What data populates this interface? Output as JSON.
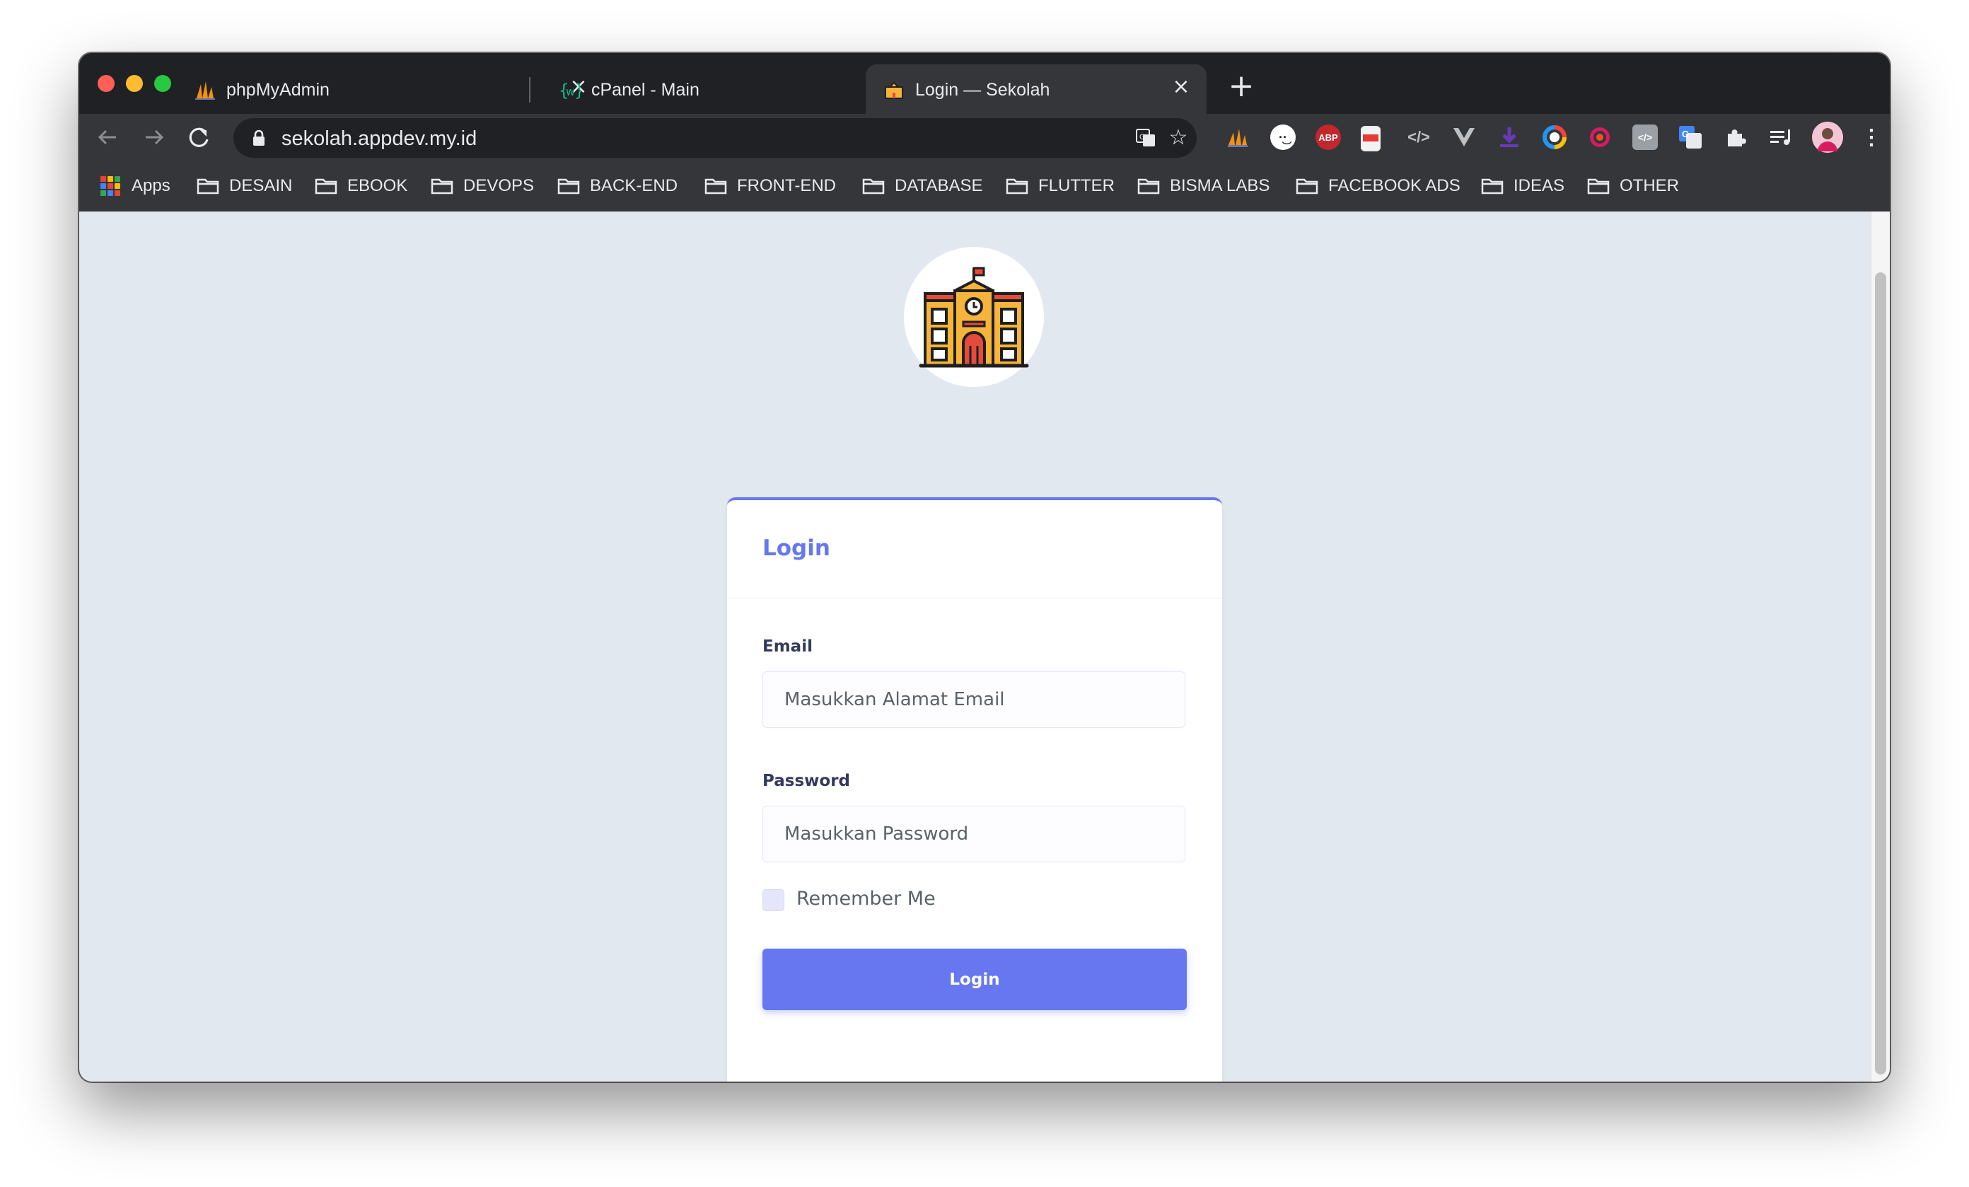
{
  "browser": {
    "tabs": [
      {
        "title": "phpMyAdmin",
        "icon": "phpmyadmin-sails-icon",
        "active": false
      },
      {
        "title": "cPanel - Main",
        "icon": "cpanel-braces-icon",
        "active": false
      },
      {
        "title": "Login — Sekolah",
        "icon": "school-building-icon",
        "active": true
      }
    ],
    "new_tab_icon": "plus-icon",
    "url": "sekolah.appdev.my.id",
    "extensions": [
      "sails-icon",
      "emoji-icon",
      "ABP",
      "pdf-icon",
      "code-icon",
      "vue-icon",
      "download-icon",
      "chromatic-icon",
      "target-icon",
      "code-box-icon",
      "translate-icon",
      "puzzle-icon",
      "media-icon",
      "avatar"
    ],
    "extension_labels": {
      "abp": "ABP"
    },
    "bookmarks": [
      {
        "label": "Apps",
        "type": "apps"
      },
      {
        "label": "DESAIN",
        "type": "folder"
      },
      {
        "label": "EBOOK",
        "type": "folder"
      },
      {
        "label": "DEVOPS",
        "type": "folder"
      },
      {
        "label": "BACK-END",
        "type": "folder"
      },
      {
        "label": "FRONT-END",
        "type": "folder"
      },
      {
        "label": "DATABASE",
        "type": "folder"
      },
      {
        "label": "FLUTTER",
        "type": "folder"
      },
      {
        "label": "BISMA LABS",
        "type": "folder"
      },
      {
        "label": "FACEBOOK ADS",
        "type": "folder"
      },
      {
        "label": "IDEAS",
        "type": "folder"
      },
      {
        "label": "OTHER",
        "type": "folder"
      }
    ]
  },
  "login": {
    "title": "Login",
    "email_label": "Email",
    "email_placeholder": "Masukkan Alamat Email",
    "password_label": "Password",
    "password_placeholder": "Masukkan Password",
    "remember_label": "Remember Me",
    "remember_checked": false,
    "submit_label": "Login"
  },
  "colors": {
    "accent": "#6777ef",
    "page_bg": "#e2e8f0",
    "chrome_dark": "#202124",
    "chrome_toolbar": "#35363a"
  }
}
